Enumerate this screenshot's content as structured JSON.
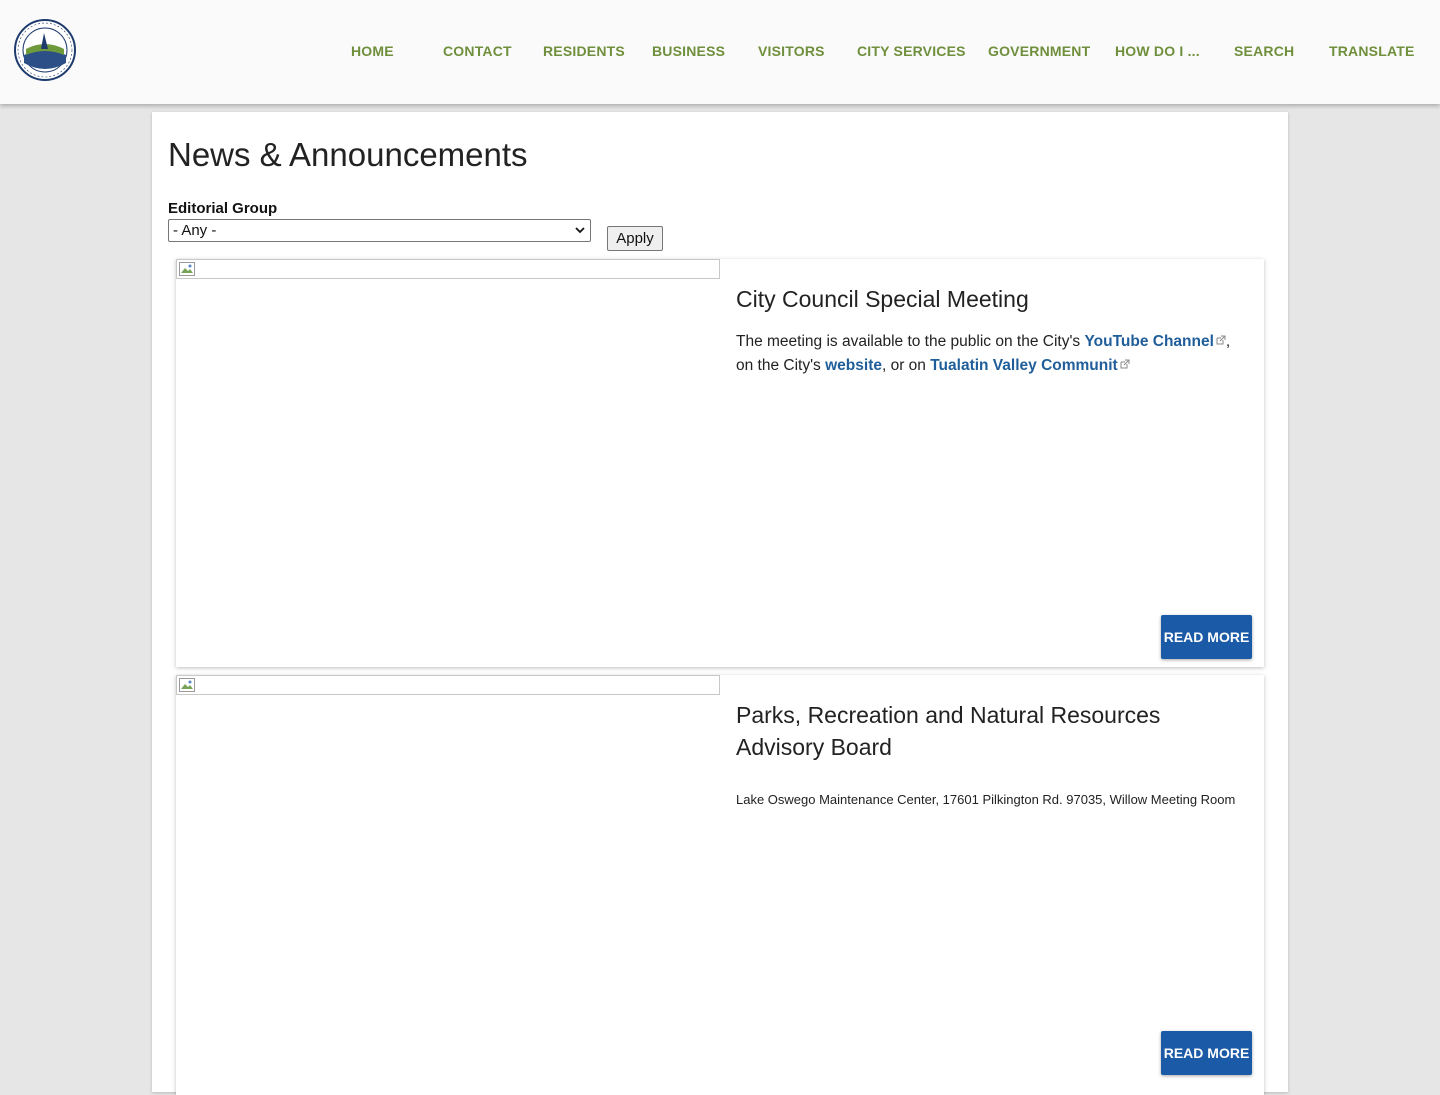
{
  "header": {
    "logo_name": "city-seal-logo",
    "nav": [
      {
        "label": "HOME"
      },
      {
        "label": "CONTACT"
      },
      {
        "label": "RESIDENTS"
      },
      {
        "label": "BUSINESS"
      },
      {
        "label": "VISITORS"
      },
      {
        "label": "CITY SERVICES"
      },
      {
        "label": "GOVERNMENT"
      },
      {
        "label": "HOW DO I ..."
      },
      {
        "label": "SEARCH"
      },
      {
        "label": "TRANSLATE"
      }
    ]
  },
  "main": {
    "title": "News & Announcements",
    "filter": {
      "label": "Editorial Group",
      "selected": "- Any -",
      "apply_label": "Apply"
    },
    "cards": [
      {
        "title": "City Council Special Meeting",
        "body_pre": "The meeting is available to the public on the City's ",
        "link1": "YouTube Channel",
        "body_mid1": ", on the City's ",
        "link2": "website",
        "body_mid2": ", or on ",
        "link3": "Tualatin Valley Communit",
        "read_more": "READ MORE"
      },
      {
        "title": "Parks, Recreation and Natural Resources Advisory Board",
        "location": "Lake Oswego Maintenance Center, 17601 Pilkington Rd. 97035, Willow Meeting Room",
        "read_more": "READ MORE"
      }
    ]
  },
  "colors": {
    "nav_text": "#6f8f3c",
    "link": "#1f5e9a",
    "button": "#1a5aa6",
    "page_bg": "#e6e6e6"
  }
}
